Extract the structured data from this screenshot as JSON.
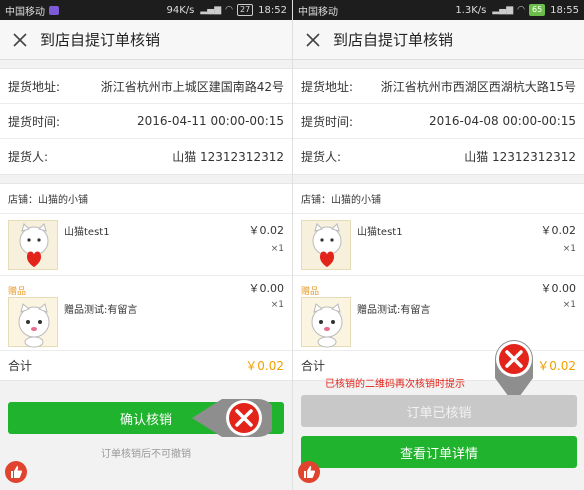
{
  "left": {
    "status": {
      "carrier": "中国移动",
      "speed": "94K/s",
      "battery": "27",
      "time": "18:52"
    },
    "header": {
      "title": "到店自提订单核销"
    },
    "info": {
      "address_label": "提货地址:",
      "address_value": "浙江省杭州市上城区建国南路42号",
      "time_label": "提货时间:",
      "time_value": "2016-04-11 00:00-00:15",
      "person_label": "提货人:",
      "person_value": "山猫 12312312312"
    },
    "shop": {
      "name": "店铺：山猫的小铺"
    },
    "items": [
      {
        "name": "山猫test1",
        "price": "￥0.02",
        "qty": "×1"
      }
    ],
    "gift": {
      "tag": "赠品",
      "name": "赠品测试:有留言",
      "price": "￥0.00",
      "qty": "×1"
    },
    "total": {
      "label": "合计",
      "value": "￥0.02"
    },
    "button": {
      "label": "确认核销"
    },
    "hint": "订单核销后不可撤销"
  },
  "right": {
    "status": {
      "carrier": "中国移动",
      "speed": "1.3K/s",
      "battery": "65",
      "time": "18:55"
    },
    "header": {
      "title": "到店自提订单核销"
    },
    "info": {
      "address_label": "提货地址:",
      "address_value": "浙江省杭州市西湖区西湖杭大路15号",
      "time_label": "提货时间:",
      "time_value": "2016-04-08 00:00-00:15",
      "person_label": "提货人:",
      "person_value": "山猫 12312312312"
    },
    "shop": {
      "name": "店铺：山猫的小铺"
    },
    "items": [
      {
        "name": "山猫test1",
        "price": "￥0.02",
        "qty": "×1"
      }
    ],
    "gift": {
      "tag": "赠品",
      "name": "赠品测试:有留言",
      "price": "￥0.00",
      "qty": "×1"
    },
    "total": {
      "label": "合计",
      "value": "￥0.02"
    },
    "annotation": "已核销的二维码再次核销时提示",
    "button_disabled": {
      "label": "订单已核销"
    },
    "button_primary": {
      "label": "查看订单详情"
    }
  },
  "colors": {
    "accent_green": "#20b32d",
    "price_orange": "#f0a000",
    "gift_orange": "#e69a26",
    "annotation_red": "#e2241a",
    "disabled_grey": "#c8c8c8"
  },
  "icons": [
    "close-icon",
    "thumbs-up-icon",
    "red-x-marker-icon",
    "wifi-icon",
    "signal-icon",
    "battery-icon"
  ]
}
